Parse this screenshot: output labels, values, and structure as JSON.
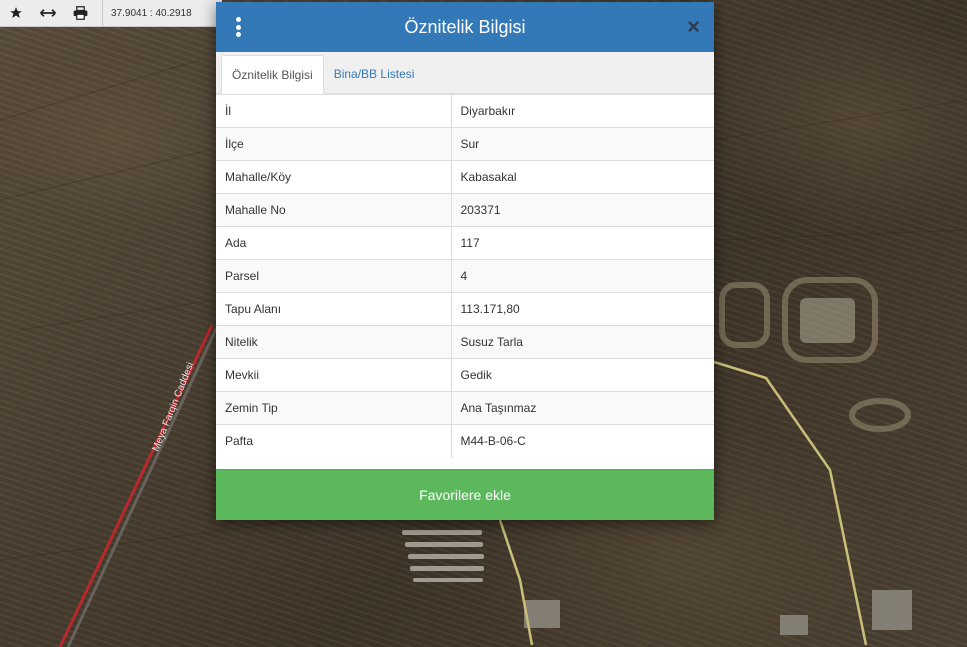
{
  "toolbar": {
    "icons": [
      "star-icon",
      "measure-icon",
      "print-icon"
    ],
    "coordinates": "37.9041 : 40.2918"
  },
  "map": {
    "road_label": "Meya Farqin Caddesi",
    "parcel_outline_color": "#c9bf7a",
    "road_color": "#b9282c"
  },
  "modal": {
    "title": "Öznitelik Bilgisi",
    "header_color": "#3379b7",
    "menu_icon": "kebab-icon",
    "close_icon": "close-icon",
    "close_label": "×",
    "tabs": [
      {
        "label": "Öznitelik Bilgisi",
        "active": true
      },
      {
        "label": "Bina/BB Listesi",
        "active": false
      }
    ],
    "rows": [
      {
        "key": "İl",
        "value": "Diyarbakır"
      },
      {
        "key": "İlçe",
        "value": "Sur"
      },
      {
        "key": "Mahalle/Köy",
        "value": "Kabasakal"
      },
      {
        "key": "Mahalle No",
        "value": "203371"
      },
      {
        "key": "Ada",
        "value": "117"
      },
      {
        "key": "Parsel",
        "value": "4"
      },
      {
        "key": "Tapu Alanı",
        "value": "113.171,80"
      },
      {
        "key": "Nitelik",
        "value": "Susuz Tarla"
      },
      {
        "key": "Mevkii",
        "value": "Gedik"
      },
      {
        "key": "Zemin Tip",
        "value": "Ana Taşınmaz"
      },
      {
        "key": "Pafta",
        "value": "M44-B-06-C"
      }
    ],
    "favorite_button": "Favorilere ekle",
    "favorite_color": "#5cb85c"
  }
}
